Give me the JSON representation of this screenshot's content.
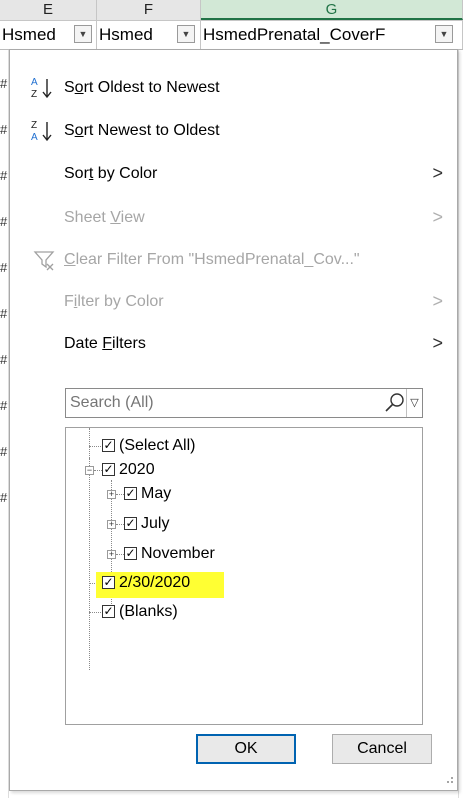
{
  "sheet": {
    "column_headers": [
      {
        "letter": "E",
        "selected": false
      },
      {
        "letter": "F",
        "selected": false
      },
      {
        "letter": "G",
        "selected": true
      }
    ],
    "header_cells": [
      "Hsmed",
      "Hsmed",
      "HsmedPrenatal_CoverF"
    ],
    "row_marker": "#",
    "accent_color": "#217346"
  },
  "menu": {
    "sort_oldest": {
      "pre": "S",
      "key": "o",
      "post": "rt Oldest to Newest"
    },
    "sort_newest": {
      "pre": "S",
      "key": "o",
      "post": "rt Newest to Oldest"
    },
    "sort_by_color": {
      "pre": "Sor",
      "key": "t",
      "post": " by Color"
    },
    "sheet_view": {
      "pre": "Sheet ",
      "key": "V",
      "post": "iew"
    },
    "clear_filter": {
      "pre": "",
      "key": "C",
      "post": "lear Filter From \"HsmedPrenatal_Cov...\""
    },
    "filter_by_color": {
      "pre": "F",
      "key": "i",
      "post": "lter by Color"
    },
    "date_filters": {
      "pre": "Date ",
      "key": "F",
      "post": "ilters"
    }
  },
  "search": {
    "placeholder": "Search (All)",
    "icon": "magnifier-icon"
  },
  "tree": {
    "select_all": "(Select All)",
    "year": "2020",
    "months": [
      "May",
      "July",
      "November"
    ],
    "highlighted_date": "2/30/2020",
    "blanks": "(Blanks)"
  },
  "buttons": {
    "ok": "OK",
    "cancel": "Cancel"
  },
  "colors": {
    "highlight": "#ffff33",
    "ok_border": "#0063b1",
    "disabled_text": "#a6a6a6"
  }
}
